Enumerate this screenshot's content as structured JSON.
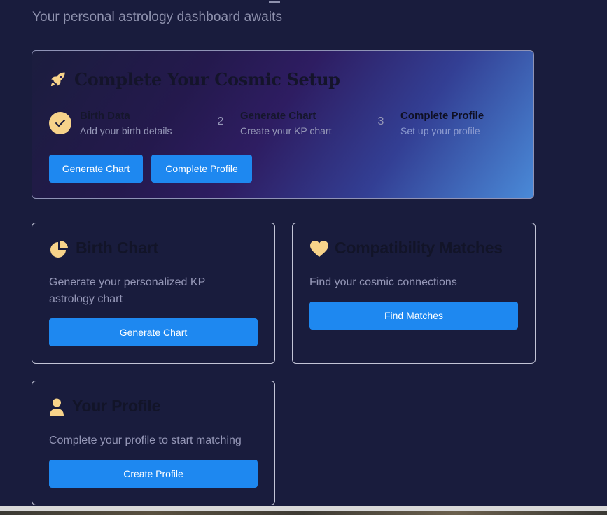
{
  "header": {
    "subtitle": "Your personal astrology dashboard awaits"
  },
  "setup": {
    "title": "Complete Your Cosmic Setup",
    "steps": [
      {
        "number": "",
        "label": "Birth Data",
        "desc": "Add your birth details",
        "status": "done"
      },
      {
        "number": "2",
        "label": "Generate Chart",
        "desc": "Create your KP chart",
        "status": "pending"
      },
      {
        "number": "3",
        "label": "Complete Profile",
        "desc": "Set up your profile",
        "status": "pending"
      }
    ],
    "buttons": {
      "generate_chart": "Generate Chart",
      "complete_profile": "Complete Profile"
    }
  },
  "cards": {
    "birth_chart": {
      "title": "Birth Chart",
      "desc": "Generate your personalized KP astrology chart",
      "button": "Generate Chart"
    },
    "compatibility": {
      "title": "Compatibility Matches",
      "desc": "Find your cosmic connections",
      "button": "Find Matches"
    },
    "profile": {
      "title": "Your Profile",
      "desc": "Complete your profile to start matching",
      "button": "Create Profile"
    }
  },
  "colors": {
    "background": "#191c3d",
    "accent": "#1e88f0",
    "icon_gold": "#f7d38a",
    "muted_text": "#9597b7"
  }
}
